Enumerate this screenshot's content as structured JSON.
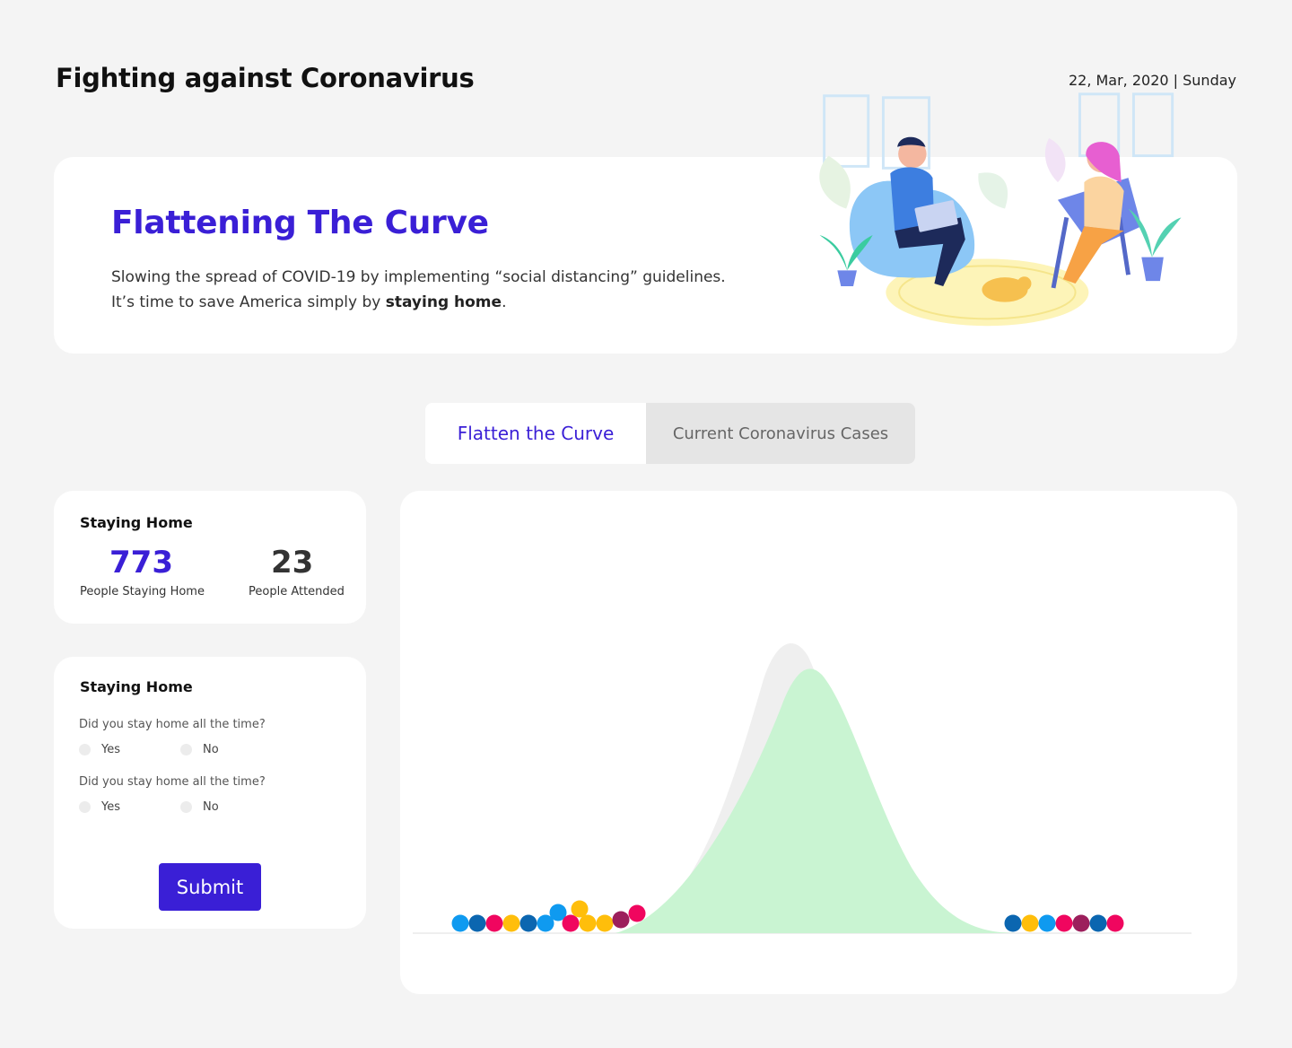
{
  "header": {
    "title": "Fighting against Coronavirus",
    "date": "22, Mar, 2020 | Sunday"
  },
  "hero": {
    "title": "Flattening The Curve",
    "line1": "Slowing the spread of COVID-19 by implementing “social distancing” guidelines.",
    "line2_prefix": "It’s time to save America simply by ",
    "line2_bold": "staying home",
    "line2_suffix": "."
  },
  "tabs": [
    {
      "label": "Flatten the Curve",
      "active": true
    },
    {
      "label": "Current Coronavirus Cases",
      "active": false
    }
  ],
  "stats_card": {
    "title": "Staying Home",
    "stats": [
      {
        "value": "773",
        "label": "People Staying Home",
        "color": "#3a1fd6"
      },
      {
        "value": "23",
        "label": "People Attended",
        "color": "#333333"
      }
    ]
  },
  "form_card": {
    "title": "Staying Home",
    "questions": [
      {
        "text": "Did you stay home all the time?",
        "options": [
          "Yes",
          "No"
        ]
      },
      {
        "text": "Did you stay home all the time?",
        "options": [
          "Yes",
          "No"
        ]
      }
    ],
    "submit_label": "Submit"
  },
  "colors": {
    "accent": "#3a1fd6",
    "curve_fill": "#c9f4d2",
    "curve_shadow": "#eeeeee",
    "dot_colors": [
      "#0f9af0",
      "#0b66b0",
      "#f0065f",
      "#ffbe0b",
      "#9c1f5c"
    ]
  }
}
